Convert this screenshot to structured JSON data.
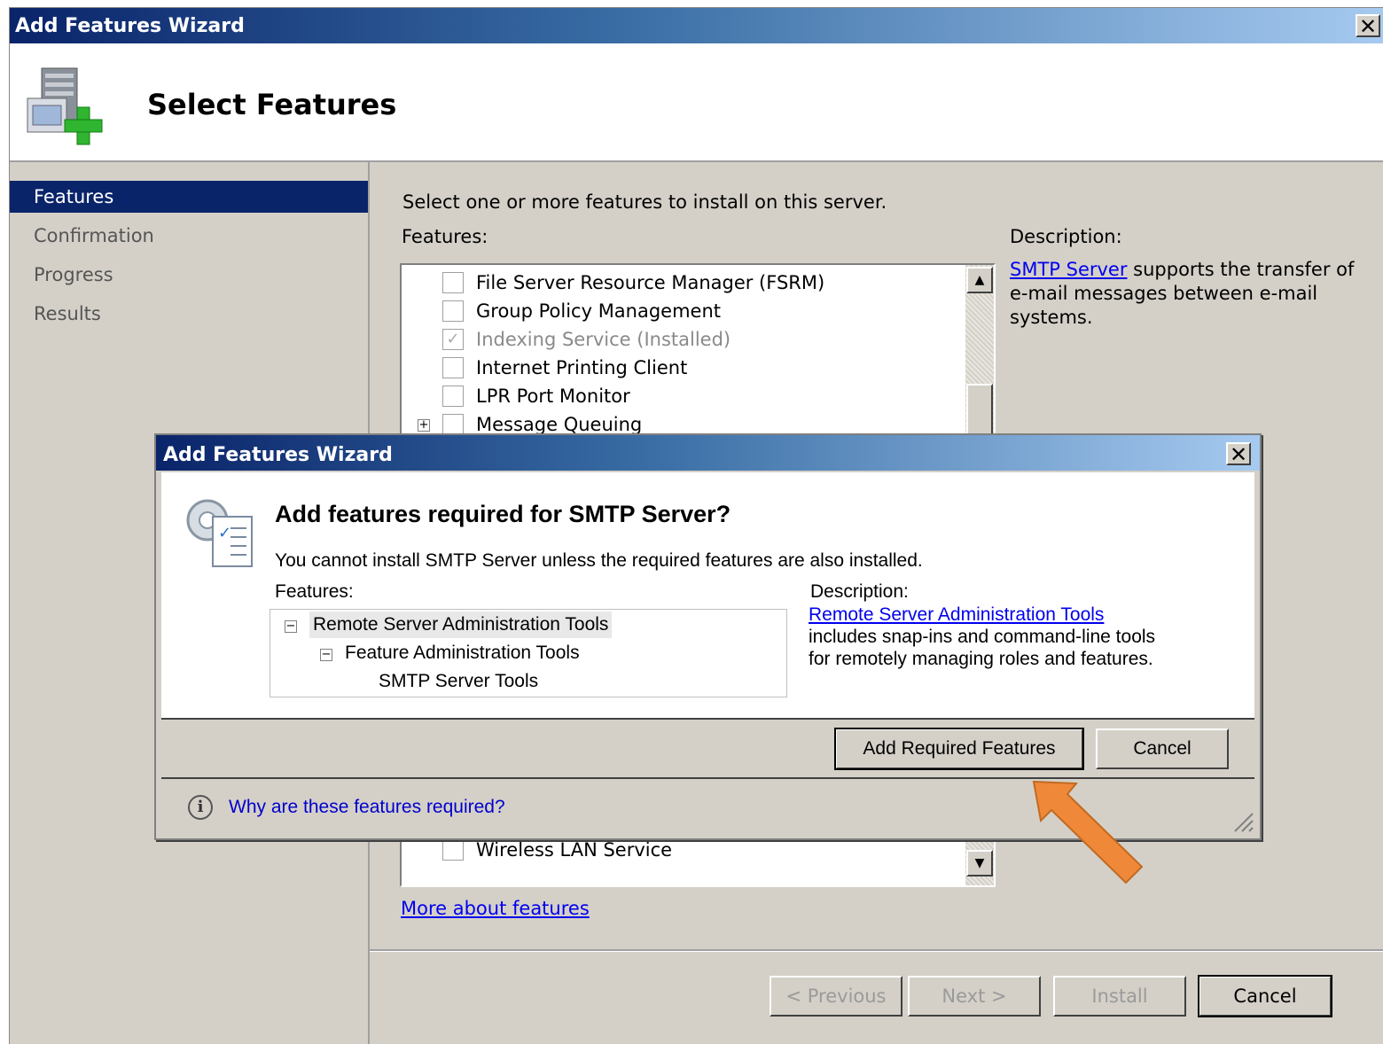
{
  "main_window": {
    "title": "Add Features Wizard",
    "close_label": "✕",
    "page_title": "Select Features"
  },
  "nav": {
    "items": [
      {
        "label": "Features",
        "active": true
      },
      {
        "label": "Confirmation",
        "active": false
      },
      {
        "label": "Progress",
        "active": false
      },
      {
        "label": "Results",
        "active": false
      }
    ]
  },
  "content": {
    "instruction": "Select one or more features to install on this server.",
    "features_label": "Features:",
    "description_label": "Description:",
    "description_link": "SMTP Server",
    "description_text": " supports the transfer of e-mail messages between e-mail systems.",
    "feature_list": [
      {
        "label": "File Server Resource Manager (FSRM)",
        "checked": false,
        "disabled": false
      },
      {
        "label": "Group Policy Management",
        "checked": false,
        "disabled": false
      },
      {
        "label": "Indexing Service  (Installed)",
        "checked": true,
        "disabled": true
      },
      {
        "label": "Internet Printing Client",
        "checked": false,
        "disabled": false
      },
      {
        "label": "LPR Port Monitor",
        "checked": false,
        "disabled": false
      },
      {
        "label": "Message Queuing",
        "checked": false,
        "disabled": false,
        "expandable": true
      }
    ],
    "feature_list_bottom": "Wireless LAN Service",
    "more_link": "More about features"
  },
  "buttons": {
    "previous": "< Previous",
    "next": "Next >",
    "install": "Install",
    "cancel": "Cancel"
  },
  "dialog": {
    "title": "Add Features Wizard",
    "close_label": "✕",
    "heading": "Add features required for SMTP Server?",
    "message": "You cannot install SMTP Server unless the required features are also installed.",
    "features_label": "Features:",
    "description_label": "Description:",
    "tree": [
      {
        "label": "Remote Server Administration Tools",
        "expander": "−"
      },
      {
        "label": "Feature Administration Tools",
        "expander": "−"
      },
      {
        "label": "SMTP Server Tools",
        "expander": ""
      }
    ],
    "description_link": "Remote Server Administration Tools",
    "description_text_1": "includes snap-ins and command-line tools",
    "description_text_2": "for remotely managing roles and features.",
    "add_button": "Add Required Features",
    "cancel_button": "Cancel",
    "help_link": "Why are these features required?",
    "help_icon": "i"
  },
  "annotation": {
    "arrow_color": "#f0883a"
  }
}
